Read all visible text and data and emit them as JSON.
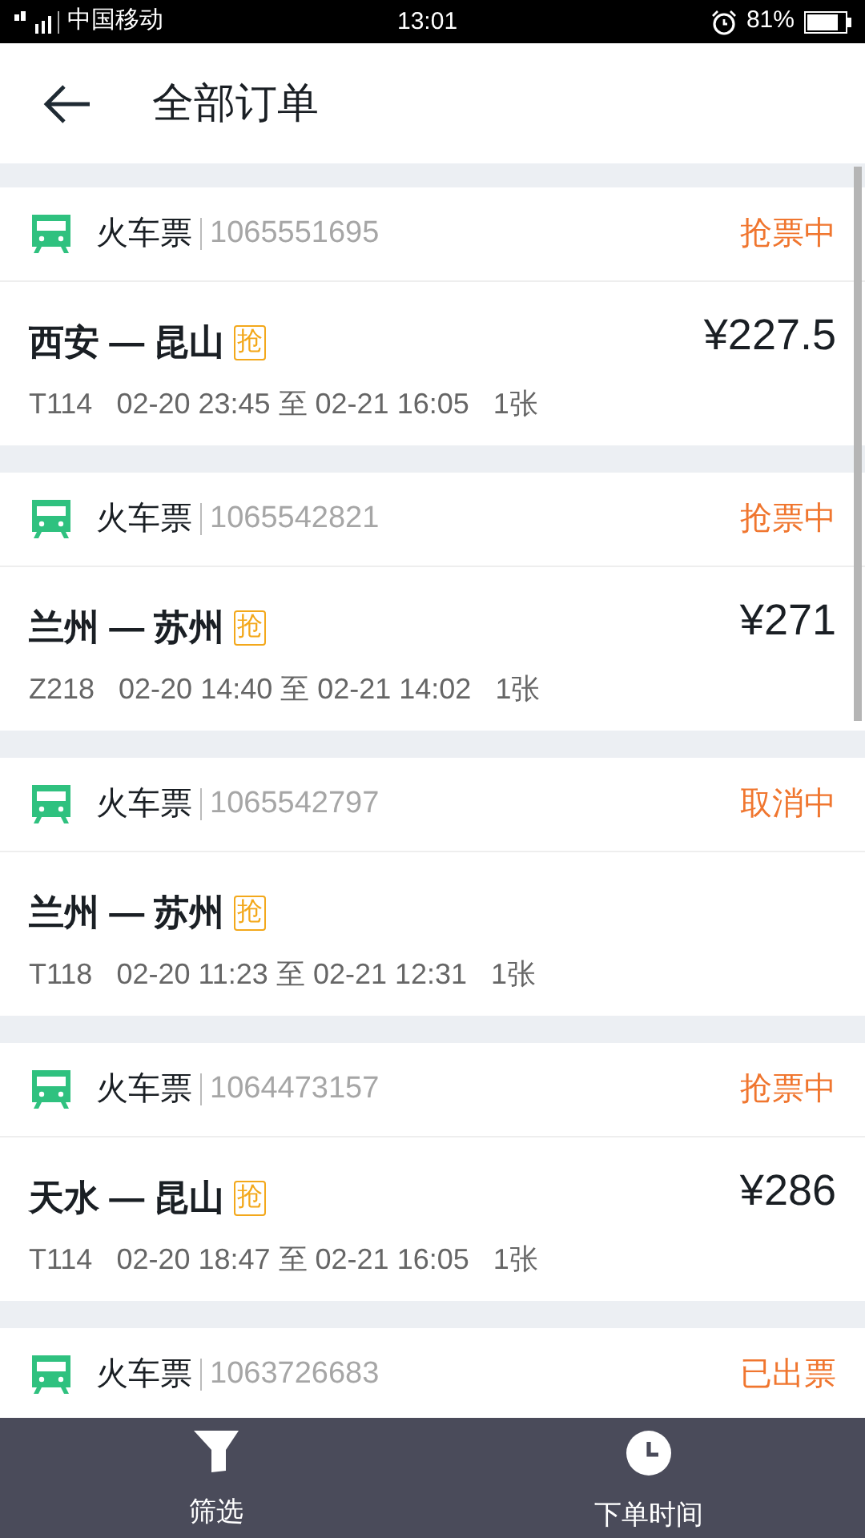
{
  "status_bar": {
    "carrier": "中国移动",
    "time": "13:01",
    "battery": "81%"
  },
  "header": {
    "title": "全部订单"
  },
  "orders": [
    {
      "category": "火车票",
      "number": "1065551695",
      "status": "抢票中",
      "route": "西安 — 昆山",
      "badge": "抢",
      "price": "¥227.5",
      "details": "T114   02-20 23:45 至 02-21 16:05   1张"
    },
    {
      "category": "火车票",
      "number": "1065542821",
      "status": "抢票中",
      "route": "兰州 — 苏州",
      "badge": "抢",
      "price": "¥271",
      "details": "Z218   02-20 14:40 至 02-21 14:02   1张"
    },
    {
      "category": "火车票",
      "number": "1065542797",
      "status": "取消中",
      "route": "兰州 — 苏州",
      "badge": "抢",
      "details": "T118   02-20 11:23 至 02-21 12:31   1张"
    },
    {
      "category": "火车票",
      "number": "1064473157",
      "status": "抢票中",
      "route": "天水 — 昆山",
      "badge": "抢",
      "price": "¥286",
      "details": "T114   02-20 18:47 至 02-21 16:05   1张"
    },
    {
      "category": "火车票",
      "number": "1063726683",
      "status": "已出票"
    }
  ],
  "bottom_bar": [
    {
      "kind": "filter",
      "label": "筛选"
    },
    {
      "kind": "time",
      "label": "下单时间"
    }
  ]
}
